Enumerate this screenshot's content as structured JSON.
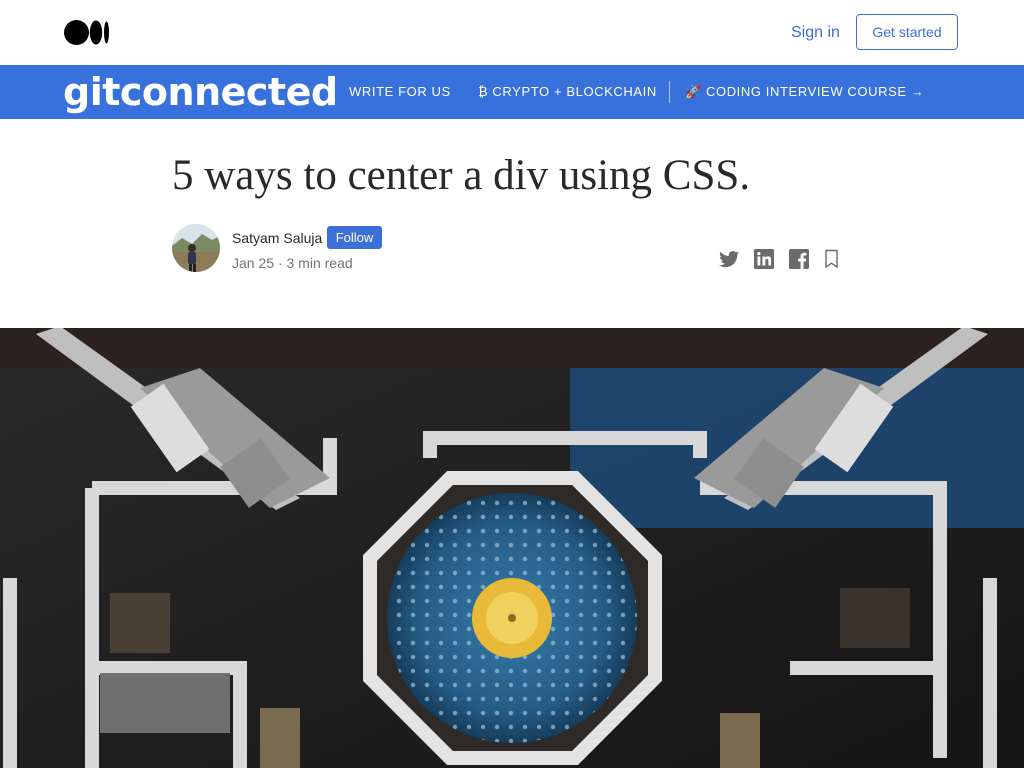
{
  "header": {
    "signin_label": "Sign in",
    "getstarted_label": "Get started"
  },
  "publication": {
    "logo_text": "gitconnected",
    "nav": [
      {
        "label": "Write for us"
      },
      {
        "label": "₿ Crypto + Blockchain"
      },
      {
        "label": "🚀 Coding Interview Course →"
      }
    ]
  },
  "article": {
    "title": "5 ways to center a div using CSS.",
    "author": "Satyam Saluja",
    "follow_label": "Follow",
    "date": "Jan 25",
    "separator": "·",
    "read_time": "3 min read"
  },
  "colors": {
    "accent": "#3d6fd9",
    "nav_bg": "#3871dc"
  },
  "icons": {
    "medium": "medium-logo",
    "twitter": "twitter-icon",
    "linkedin": "linkedin-icon",
    "facebook": "facebook-icon",
    "bookmark": "bookmark-icon"
  }
}
